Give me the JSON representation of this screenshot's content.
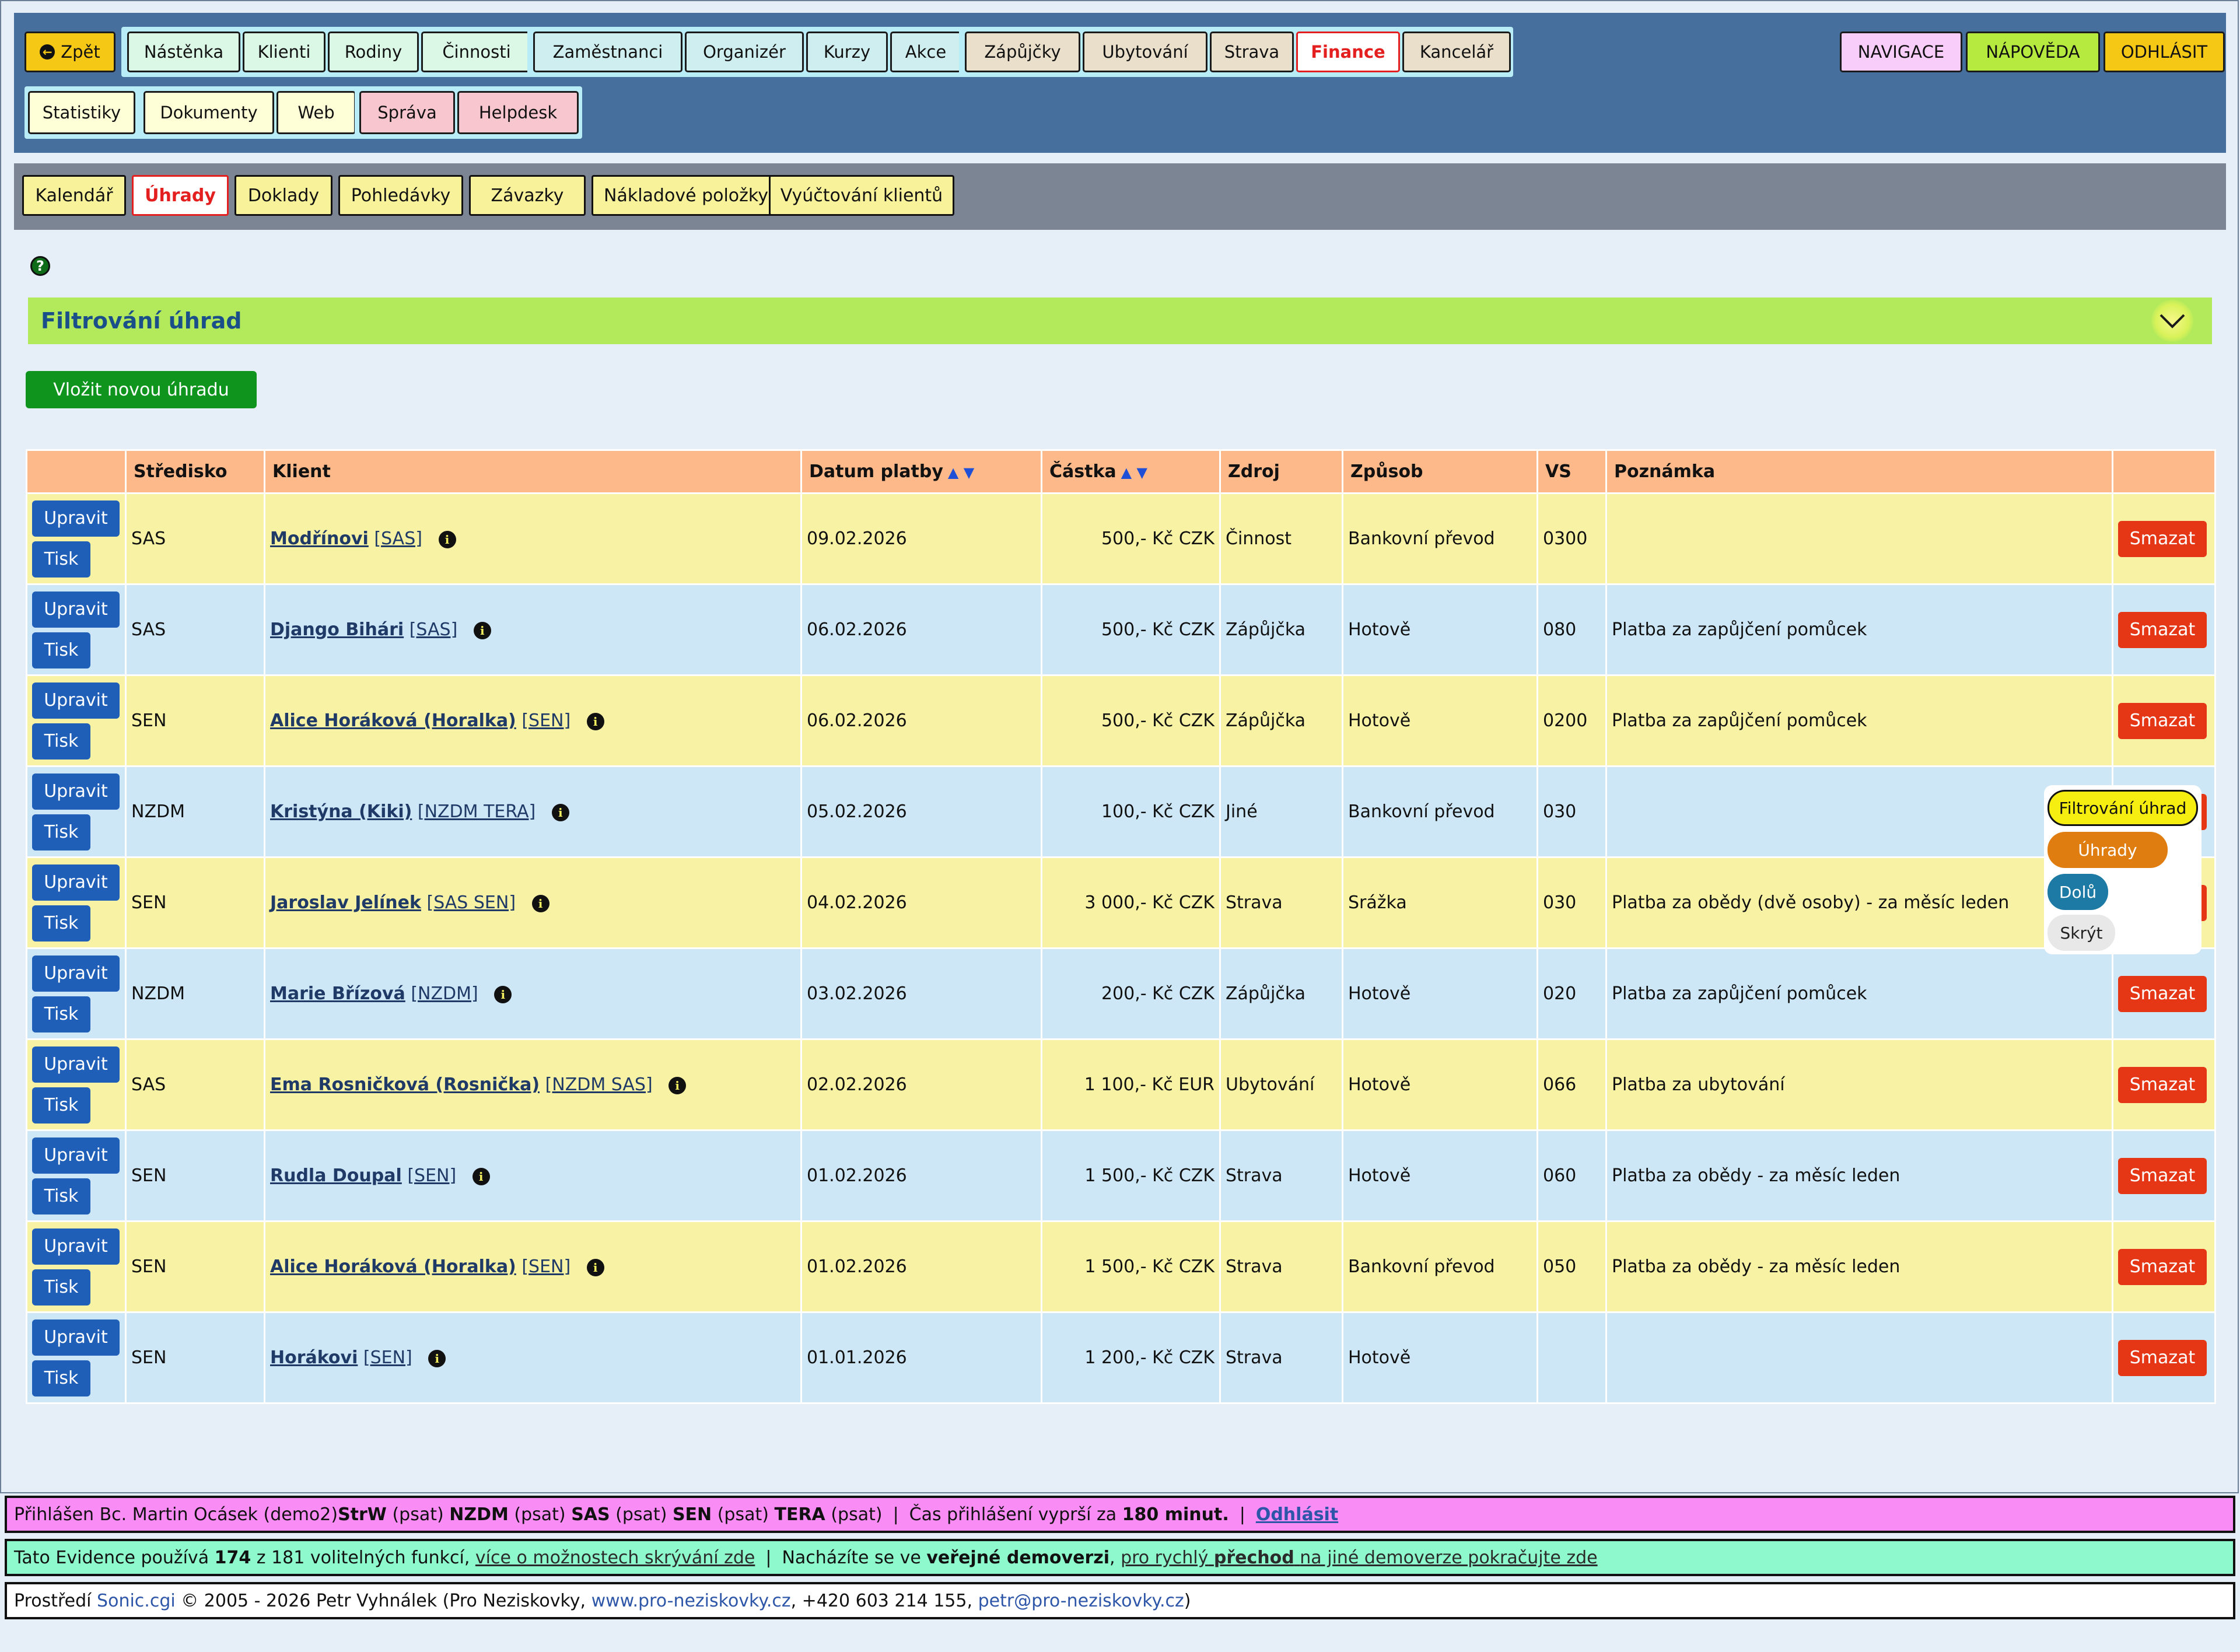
{
  "topnav": {
    "back": "Zpět",
    "group1": [
      "Nástěnka",
      "Klienti",
      "Rodiny",
      "Činnosti"
    ],
    "group2": [
      "Zaměstnanci",
      "Organizér",
      "Kurzy",
      "Akce"
    ],
    "group3": [
      "Zápůjčky",
      "Ubytování",
      "Strava",
      "Finance",
      "Kancelář"
    ],
    "row2_group1": [
      "Statistiky",
      "Dokumenty",
      "Web"
    ],
    "row2_group2": [
      "Správa",
      "Helpdesk"
    ],
    "right": {
      "navigation": "NAVIGACE",
      "help": "NÁPOVĚDA",
      "logout": "ODHLÁSIT"
    },
    "active": "Finance"
  },
  "subnav": {
    "items": [
      "Kalendář",
      "Úhrady",
      "Doklady",
      "Pohledávky",
      "Závazky",
      "Nákladové položky",
      "Vyúčtování klientů"
    ],
    "active": "Úhrady"
  },
  "filter": {
    "title": "Filtrování úhrad"
  },
  "add_button": "Vložit novou úhradu",
  "table": {
    "headers": [
      "",
      "Středisko",
      "Klient",
      "Datum platby",
      "Částka",
      "Zdroj",
      "Způsob",
      "VS",
      "Poznámka",
      ""
    ],
    "edit_label": "Upravit",
    "print_label": "Tisk",
    "delete_label": "Smazat",
    "rows": [
      {
        "center": "SAS",
        "client": "Modřínovi",
        "client_center": "[SAS]",
        "date": "09.02.2026",
        "amount": "500,- Kč CZK",
        "source": "Činnost",
        "method": "Bankovní převod",
        "vs": "0300",
        "note": ""
      },
      {
        "center": "SAS",
        "client": "Django Bihári",
        "client_center": "[SAS]",
        "date": "06.02.2026",
        "amount": "500,- Kč CZK",
        "source": "Zápůjčka",
        "method": "Hotově",
        "vs": "080",
        "note": "Platba za zapůjčení pomůcek"
      },
      {
        "center": "SEN",
        "client": "Alice Horáková (Horalka)",
        "client_center": "[SEN]",
        "date": "06.02.2026",
        "amount": "500,- Kč CZK",
        "source": "Zápůjčka",
        "method": "Hotově",
        "vs": "0200",
        "note": "Platba za zapůjčení pomůcek"
      },
      {
        "center": "NZDM",
        "client": "Kristýna (Kiki)",
        "client_center": "[NZDM TERA]",
        "date": "05.02.2026",
        "amount": "100,- Kč CZK",
        "source": "Jiné",
        "method": "Bankovní převod",
        "vs": "030",
        "note": ""
      },
      {
        "center": "SEN",
        "client": "Jaroslav Jelínek",
        "client_center": "[SAS SEN]",
        "date": "04.02.2026",
        "amount": "3 000,- Kč CZK",
        "source": "Strava",
        "method": "Srážka",
        "vs": "030",
        "note": "Platba za obědy (dvě osoby) - za měsíc leden"
      },
      {
        "center": "NZDM",
        "client": "Marie Břízová",
        "client_center": "[NZDM]",
        "date": "03.02.2026",
        "amount": "200,- Kč CZK",
        "source": "Zápůjčka",
        "method": "Hotově",
        "vs": "020",
        "note": "Platba za zapůjčení pomůcek"
      },
      {
        "center": "SAS",
        "client": "Ema Rosničková (Rosnička)",
        "client_center": "[NZDM SAS]",
        "date": "02.02.2026",
        "amount": "1 100,- Kč EUR",
        "source": "Ubytování",
        "method": "Hotově",
        "vs": "066",
        "note": "Platba za ubytování"
      },
      {
        "center": "SEN",
        "client": "Rudla Doupal",
        "client_center": "[SEN]",
        "date": "01.02.2026",
        "amount": "1 500,- Kč CZK",
        "source": "Strava",
        "method": "Hotově",
        "vs": "060",
        "note": "Platba za obědy - za měsíc leden"
      },
      {
        "center": "SEN",
        "client": "Alice Horáková (Horalka)",
        "client_center": "[SEN]",
        "date": "01.02.2026",
        "amount": "1 500,- Kč CZK",
        "source": "Strava",
        "method": "Bankovní převod",
        "vs": "050",
        "note": "Platba za obědy - za měsíc leden"
      },
      {
        "center": "SEN",
        "client": "Horákovi",
        "client_center": "[SEN]",
        "date": "01.01.2026",
        "amount": "1 200,- Kč CZK",
        "source": "Strava",
        "method": "Hotově",
        "vs": "",
        "note": ""
      }
    ]
  },
  "float_menu": {
    "filter": "Filtrování úhrad",
    "payments": "Úhrady",
    "down": "Dolů",
    "hide": "Skrýt"
  },
  "footer": {
    "login_prefix": "Přihlášen Bc. Martin Ocásek (demo2)",
    "units": [
      {
        "code": "StrW",
        "mode": "(psat)"
      },
      {
        "code": "NZDM",
        "mode": "(psat)"
      },
      {
        "code": "SAS",
        "mode": "(psat)"
      },
      {
        "code": "SEN",
        "mode": "(psat)"
      },
      {
        "code": "TERA",
        "mode": "(psat)"
      }
    ],
    "session_prefix": "Čas přihlášení vyprší za",
    "session_value": "180 minut.",
    "logout": "Odhlásit",
    "features_prefix": "Tato Evidence používá",
    "features_used": "174",
    "features_total_text": "z 181 volitelných funkcí,",
    "features_link": "více o možnostech skrývání zde",
    "demo_prefix": "Nacházíte se ve",
    "demo_bold": "veřejné demoverzi",
    "switch_a": "pro rychlý",
    "switch_bold": "přechod",
    "switch_b": "na jiné demoverze pokračujte zde",
    "copy_prefix": "Prostředí",
    "copy_sonic": "Sonic.cgi",
    "copy_mid": "© 2005 - 2026 Petr Vyhnálek (Pro Neziskovky,",
    "copy_web": "www.pro-neziskovky.cz",
    "copy_phone": ", +420 603 214 155,",
    "copy_email": "petr@pro-neziskovky.cz",
    "copy_end": ")"
  },
  "colors": {
    "nav_bg": "#466f9e",
    "subnav_bg": "#7b8593",
    "filter_bg": "#b3ea5b",
    "row_yellow": "#f8f3a4",
    "row_blue": "#cde7f7",
    "delete": "#e53716",
    "action": "#1f5fb8"
  }
}
